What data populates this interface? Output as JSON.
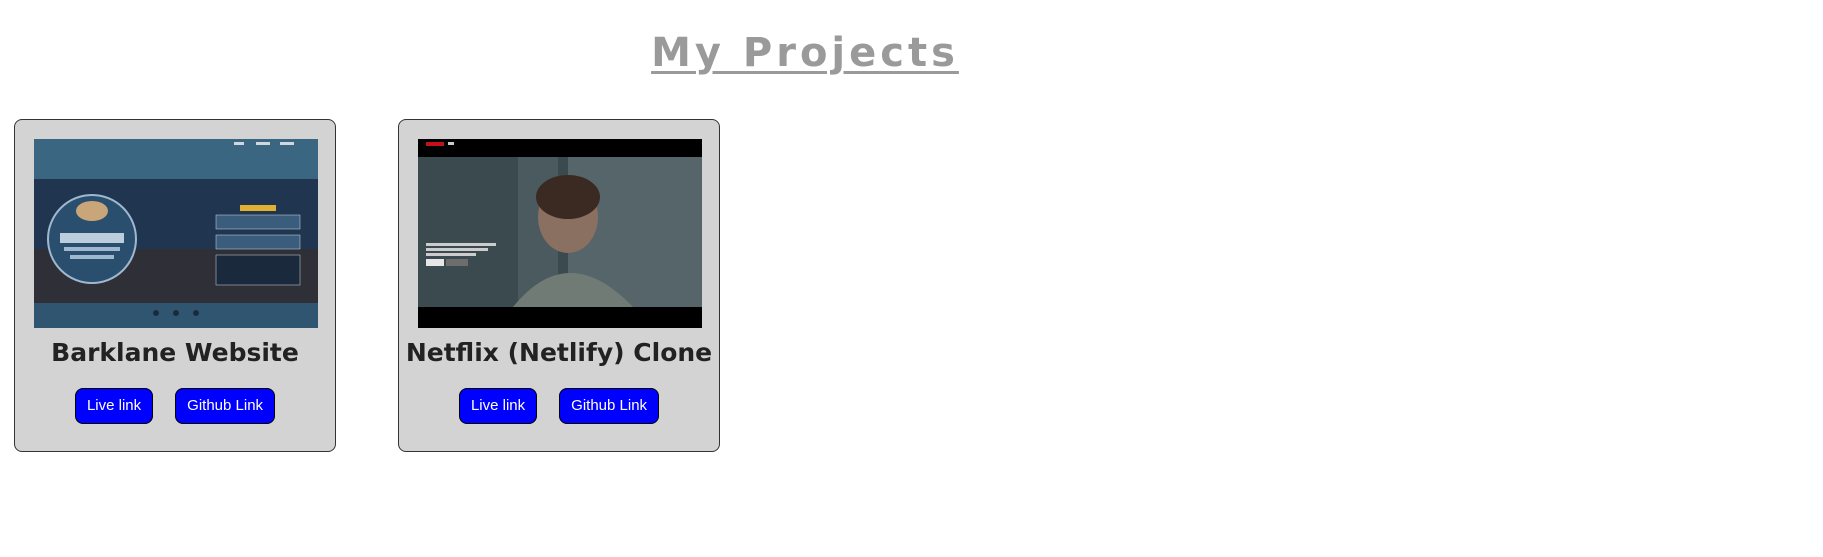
{
  "page": {
    "title": "My Projects",
    "title_color": "#9a9a9a"
  },
  "projects": [
    {
      "title": "Barklane Website",
      "thumbnail": "barklane-website-screenshot",
      "live_label": "Live link",
      "github_label": "Github Link"
    },
    {
      "title": "Netflix (Netlify) Clone",
      "thumbnail": "netflix-clone-screenshot",
      "live_label": "Live link",
      "github_label": "Github Link"
    }
  ],
  "colors": {
    "card_bg": "#d3d3d3",
    "button_bg": "#0000ff",
    "button_text": "#ffffff"
  }
}
